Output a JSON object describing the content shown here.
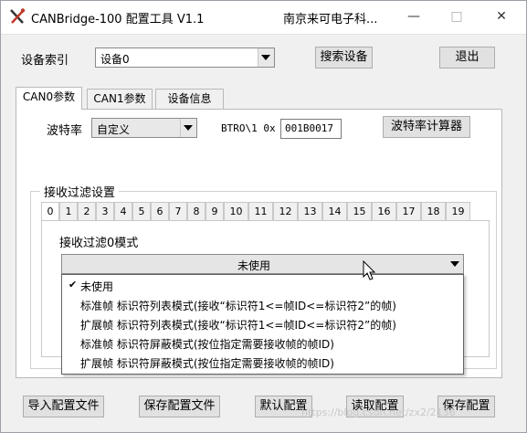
{
  "window": {
    "title": "CANBridge-100 配置工具 V1.1",
    "center_title": "南京来可电子科...",
    "minimize": "—",
    "maximize": "□",
    "close": "✕"
  },
  "device": {
    "index_label": "设备索引",
    "selected": "设备0",
    "search_button": "搜索设备",
    "exit_button": "退出"
  },
  "tabs": [
    {
      "label": "CAN0参数",
      "active": true
    },
    {
      "label": "CAN1参数",
      "active": false
    },
    {
      "label": "设备信息",
      "active": false
    }
  ],
  "baud": {
    "label": "波特率",
    "selected": "自定义",
    "btr_label": "BTRO\\1 0x",
    "btr_value": "001B0017",
    "calc_button": "波特率计算器"
  },
  "filter": {
    "group_title": "接收过滤设置",
    "tabs": [
      "0",
      "1",
      "2",
      "3",
      "4",
      "5",
      "6",
      "7",
      "8",
      "9",
      "10",
      "11",
      "12",
      "13",
      "14",
      "15",
      "16",
      "17",
      "18",
      "19"
    ],
    "active_tab": "0",
    "mode_label": "接收过滤0模式",
    "mode_selected": "未使用",
    "options": [
      {
        "label": "未使用",
        "checked": true
      },
      {
        "label": "标准帧 标识符列表模式(接收“标识符1<=帧ID<=标识符2”的帧)",
        "checked": false
      },
      {
        "label": "扩展帧 标识符列表模式(接收“标识符1<=帧ID<=标识符2”的帧)",
        "checked": false
      },
      {
        "label": "标准帧 标识符屏蔽模式(按位指定需要接收帧的帧ID)",
        "checked": false
      },
      {
        "label": "扩展帧 标识符屏蔽模式(按位指定需要接收帧的帧ID)",
        "checked": false
      }
    ]
  },
  "bottom": {
    "import": "导入配置文件",
    "save_file": "保存配置文件",
    "default": "默认配置",
    "read": "读取配置",
    "save": "保存配置"
  },
  "watermark": "https://blog.csdn.net/zx2/2136"
}
